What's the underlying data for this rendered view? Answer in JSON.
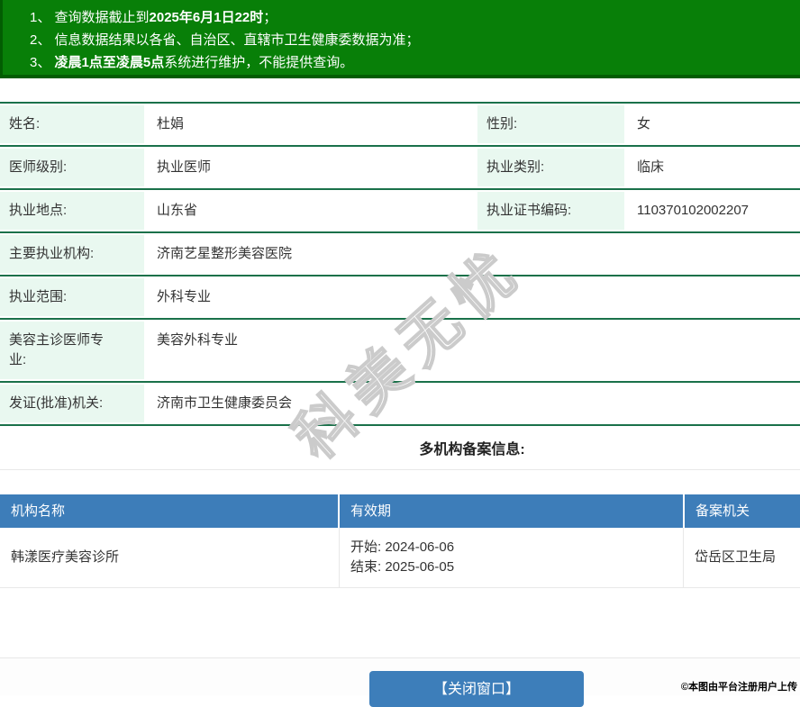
{
  "colors": {
    "notice-bg": "#087f08",
    "notice-border": "#025d02",
    "table-border-green": "#1a714a",
    "label-bg": "#e9f8f0",
    "header-blue": "#3d7db9",
    "button-blue": "#3d7eba",
    "divider-gray": "#e8e8e8"
  },
  "notices": {
    "line1": {
      "pre": "1、 查询数据截止到",
      "bold": "2025年6月1日22时",
      "post": "；"
    },
    "line2": {
      "pre": "2、 信息数据结果以各省、自治区、直辖市卫生健康委数据为准；",
      "bold": "",
      "post": ""
    },
    "line3": {
      "pre": "3、 ",
      "bold": "凌晨1点至凌晨5点",
      "post": "系统进行维护，不能提供查询。"
    }
  },
  "info_table": {
    "rows": [
      {
        "label1": "姓名:",
        "value1": "杜娟",
        "label2": "性别:",
        "value2": "女"
      },
      {
        "label1": "医师级别:",
        "value1": "执业医师",
        "label2": "执业类别:",
        "value2": "临床"
      },
      {
        "label1": "执业地点:",
        "value1": "山东省",
        "label2": "执业证书编码:",
        "value2": "110370102002207"
      },
      {
        "label1": "主要执业机构:",
        "value1": "济南艺星整形美容医院"
      },
      {
        "label1": "执业范围:",
        "value1": "外科专业"
      },
      {
        "label1": "美容主诊医师专业:",
        "value1": "美容外科专业"
      },
      {
        "label1": "发证(批准)机关:",
        "value1": "济南市卫生健康委员会"
      }
    ]
  },
  "section_title": "多机构备案信息:",
  "filing_table": {
    "headers": [
      "机构名称",
      "有效期",
      "备案机关"
    ],
    "row": {
      "name": "韩漾医疗美容诊所",
      "validity_start": "开始: 2024-06-06",
      "validity_end": "结束: 2025-06-05",
      "agency": "岱岳区卫生局"
    }
  },
  "watermark": "科美无忧",
  "footer": {
    "close_button": "【关闭窗口】",
    "copyright": "©本图由平台注册用户上传"
  }
}
